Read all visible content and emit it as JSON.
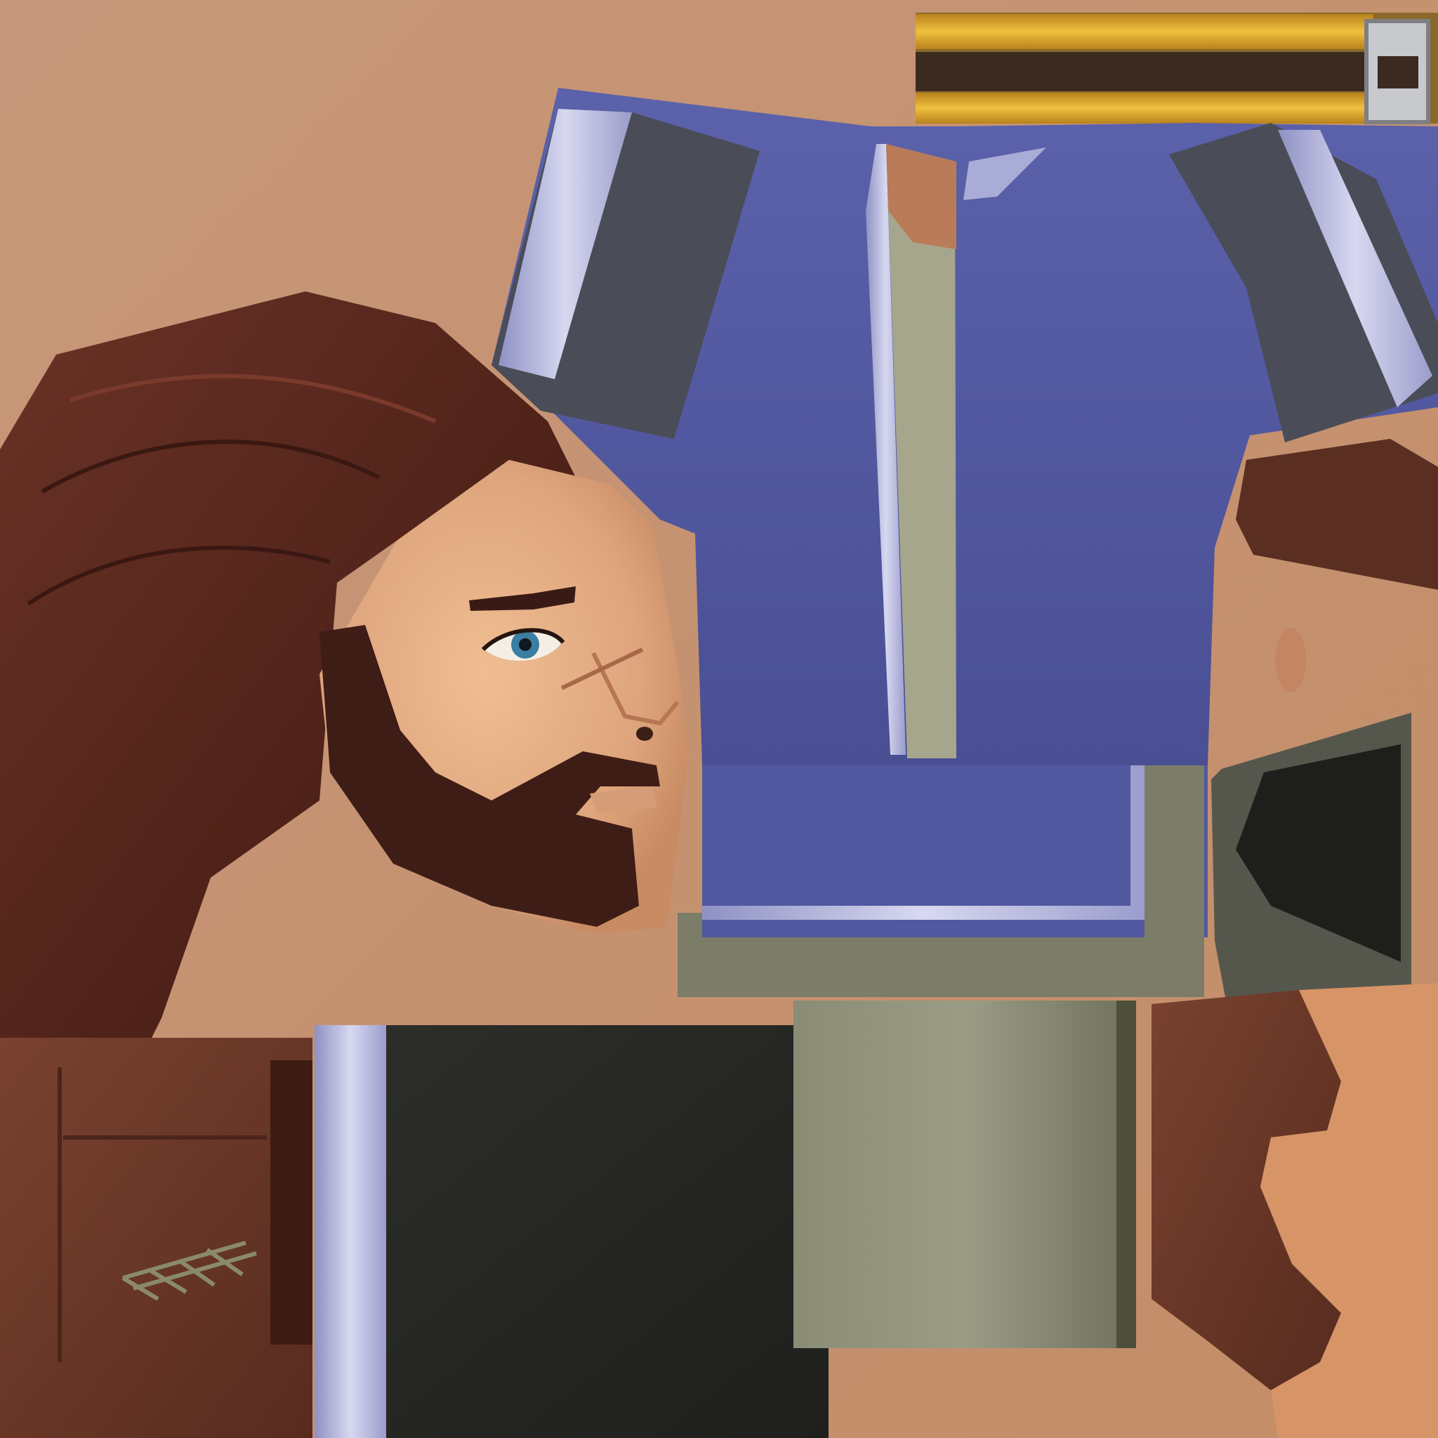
{
  "texture_atlas": {
    "description_tags": [
      "character-texture-atlas"
    ],
    "palette": {
      "skin": "#d69a73",
      "skin_shadow": "#c0875f",
      "hair": "#5a2a22",
      "hair_dark": "#3a1a15",
      "beard": "#3f1d17",
      "shirt_blue": "#5158a0",
      "shirt_blue_light": "#6066ad",
      "trim_lavender": "#a9acd6",
      "sleeve_gray": "#4a4c57",
      "undershirt": "#a5a68c",
      "cloth_olive": "#7d7f6a",
      "dark_cloth": "#2a2b28",
      "leather_brown": "#6d3a29",
      "gold": "#d8a22a",
      "strap_dark": "#3a2b22",
      "buckle_metal": "#bfc0c4",
      "eye_blue": "#3a7ea3"
    },
    "regions": [
      "belt-strip",
      "shirt-front",
      "left-sleeve",
      "right-sleeve",
      "undershirt-panel",
      "collar-flap",
      "hair",
      "face",
      "beard",
      "eye",
      "eyebrow",
      "ear",
      "shirt-hem",
      "olive-skirt",
      "boot-cuff",
      "hair-tie",
      "leather-vest",
      "dark-trousers",
      "olive-cloth-panel",
      "leather-glove",
      "hand-skin"
    ]
  }
}
